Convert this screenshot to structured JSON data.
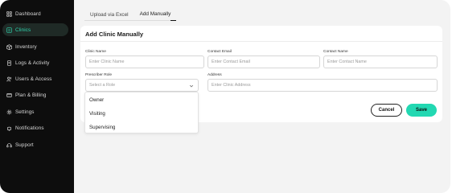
{
  "sidebar": {
    "items": [
      {
        "label": "Dashboard",
        "icon": "dashboard-icon",
        "active": false
      },
      {
        "label": "Clinics",
        "icon": "clinic-icon",
        "active": true
      },
      {
        "label": "Inventory",
        "icon": "box-icon",
        "active": false
      },
      {
        "label": "Logs & Activity",
        "icon": "log-icon",
        "active": false
      },
      {
        "label": "Users & Access",
        "icon": "users-icon",
        "active": false
      },
      {
        "label": "Plan & Billing",
        "icon": "billing-icon",
        "active": false
      },
      {
        "label": "Settings",
        "icon": "gear-icon",
        "active": false
      },
      {
        "label": "Notifications",
        "icon": "bell-icon",
        "active": false
      },
      {
        "label": "Support",
        "icon": "headset-icon",
        "active": false
      }
    ]
  },
  "tabs": [
    {
      "label": "Upload via Excel",
      "active": false
    },
    {
      "label": "Add Manually",
      "active": true
    }
  ],
  "form": {
    "title": "Add Clinic Manually",
    "clinic_name": {
      "label": "Clinic Name",
      "placeholder": "Enter Clinic Name"
    },
    "contact_email": {
      "label": "Contact Email",
      "placeholder": "Enter Contact Email"
    },
    "contact_name": {
      "label": "Contact Name",
      "placeholder": "Enter Contact Name"
    },
    "prescriber_role": {
      "label": "Prescriber Role",
      "placeholder": "Select a Role",
      "options": [
        "Owner",
        "Visiting",
        "Supervising"
      ]
    },
    "address": {
      "label": "Address",
      "placeholder": "Enter Clinic Address"
    }
  },
  "actions": {
    "cancel": "Cancel",
    "save": "Save"
  },
  "colors": {
    "accent": "#22d8b2",
    "sidebar_bg": "#0d0d0d",
    "active_text": "#2fd6b0"
  }
}
